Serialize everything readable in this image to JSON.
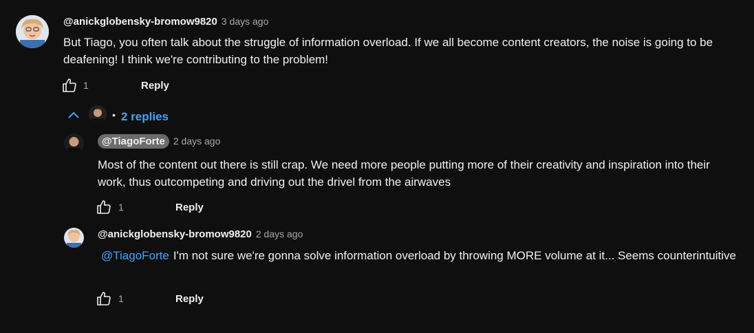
{
  "comment": {
    "author": "@anickglobensky-bromow9820",
    "time": "3 days ago",
    "text": "But Tiago, you often talk about the struggle of information overload. If we all become content creators, the noise is going to be deafening! I think we're contributing to the problem!",
    "likes": "1",
    "reply_label": "Reply",
    "replies_toggle": "2 replies",
    "bullet": "•"
  },
  "replies": [
    {
      "author": "@TiagoForte",
      "time": "2 days ago",
      "text": "Most of the content out there is still crap. We need more people putting more of their creativity and inspiration into their work, thus outcompeting and driving out the drivel from the airwaves",
      "likes": "1",
      "reply_label": "Reply"
    },
    {
      "author": "@anickglobensky-bromow9820",
      "time": "2 days ago",
      "mention": "@TiagoForte",
      "text": "I'm not sure we're gonna solve information overload by throwing MORE volume at it... Seems counterintuitive",
      "likes": "1",
      "reply_label": "Reply"
    }
  ],
  "colors": {
    "background": "#0f0f0f",
    "link": "#3ea6ff",
    "secondary_text": "#aaaaaa"
  },
  "icons": [
    "like-icon",
    "chevron-up-icon"
  ]
}
